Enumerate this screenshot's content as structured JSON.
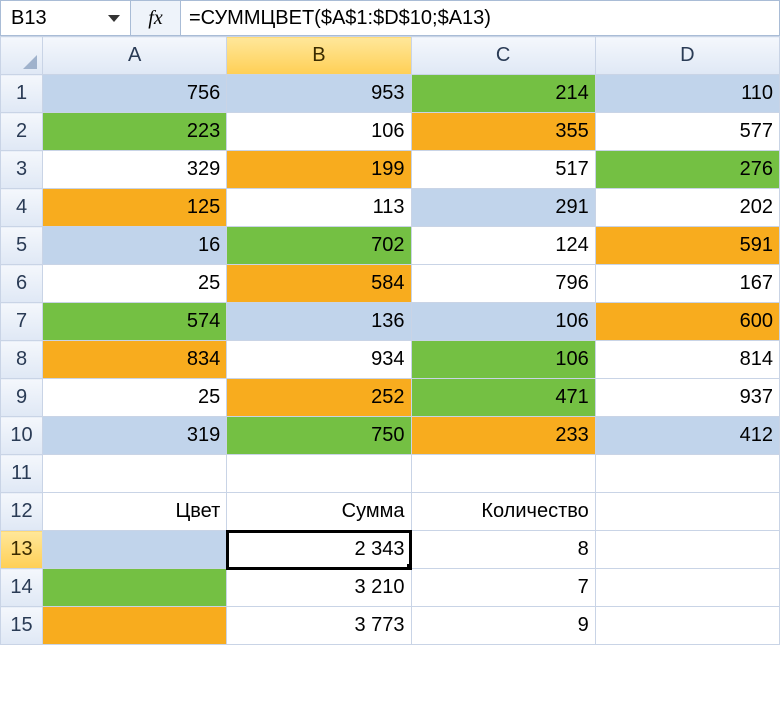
{
  "name_box": "B13",
  "fx_label": "fx",
  "formula": "=СУММЦВЕТ($A$1:$D$10;$A13)",
  "columns": [
    "A",
    "B",
    "C",
    "D"
  ],
  "selected_col": "B",
  "selected_row": "13",
  "rows": [
    "1",
    "2",
    "3",
    "4",
    "5",
    "6",
    "7",
    "8",
    "9",
    "10",
    "11",
    "12",
    "13",
    "14",
    "15"
  ],
  "grid": [
    [
      {
        "v": "756",
        "c": "blue"
      },
      {
        "v": "953",
        "c": "blue"
      },
      {
        "v": "214",
        "c": "green"
      },
      {
        "v": "110",
        "c": "blue"
      }
    ],
    [
      {
        "v": "223",
        "c": "green"
      },
      {
        "v": "106",
        "c": "none"
      },
      {
        "v": "355",
        "c": "orange"
      },
      {
        "v": "577",
        "c": "none"
      }
    ],
    [
      {
        "v": "329",
        "c": "none"
      },
      {
        "v": "199",
        "c": "orange"
      },
      {
        "v": "517",
        "c": "none"
      },
      {
        "v": "276",
        "c": "green"
      }
    ],
    [
      {
        "v": "125",
        "c": "orange"
      },
      {
        "v": "113",
        "c": "none"
      },
      {
        "v": "291",
        "c": "blue"
      },
      {
        "v": "202",
        "c": "none"
      }
    ],
    [
      {
        "v": "16",
        "c": "blue"
      },
      {
        "v": "702",
        "c": "green"
      },
      {
        "v": "124",
        "c": "none"
      },
      {
        "v": "591",
        "c": "orange"
      }
    ],
    [
      {
        "v": "25",
        "c": "none"
      },
      {
        "v": "584",
        "c": "orange"
      },
      {
        "v": "796",
        "c": "none"
      },
      {
        "v": "167",
        "c": "none"
      }
    ],
    [
      {
        "v": "574",
        "c": "green"
      },
      {
        "v": "136",
        "c": "blue"
      },
      {
        "v": "106",
        "c": "blue"
      },
      {
        "v": "600",
        "c": "orange"
      }
    ],
    [
      {
        "v": "834",
        "c": "orange"
      },
      {
        "v": "934",
        "c": "none"
      },
      {
        "v": "106",
        "c": "green"
      },
      {
        "v": "814",
        "c": "none"
      }
    ],
    [
      {
        "v": "25",
        "c": "none"
      },
      {
        "v": "252",
        "c": "orange"
      },
      {
        "v": "471",
        "c": "green"
      },
      {
        "v": "937",
        "c": "none"
      }
    ],
    [
      {
        "v": "319",
        "c": "blue"
      },
      {
        "v": "750",
        "c": "green"
      },
      {
        "v": "233",
        "c": "orange"
      },
      {
        "v": "412",
        "c": "blue"
      }
    ],
    [
      {
        "v": "",
        "c": "none"
      },
      {
        "v": "",
        "c": "none"
      },
      {
        "v": "",
        "c": "none"
      },
      {
        "v": "",
        "c": "none"
      }
    ],
    [
      {
        "v": "Цвет",
        "c": "none",
        "t": true
      },
      {
        "v": "Сумма",
        "c": "none",
        "t": true
      },
      {
        "v": "Количество",
        "c": "none",
        "t": true
      },
      {
        "v": "",
        "c": "none"
      }
    ],
    [
      {
        "v": "",
        "c": "blue"
      },
      {
        "v": "2 343",
        "c": "none",
        "sel": true
      },
      {
        "v": "8",
        "c": "none"
      },
      {
        "v": "",
        "c": "none"
      }
    ],
    [
      {
        "v": "",
        "c": "green"
      },
      {
        "v": "3 210",
        "c": "none"
      },
      {
        "v": "7",
        "c": "none"
      },
      {
        "v": "",
        "c": "none"
      }
    ],
    [
      {
        "v": "",
        "c": "orange"
      },
      {
        "v": "3 773",
        "c": "none"
      },
      {
        "v": "9",
        "c": "none"
      },
      {
        "v": "",
        "c": "none"
      }
    ]
  ],
  "chart_data": {
    "type": "table",
    "title": "Spreadsheet data with color-coded cells and sum-by-color results",
    "columns": [
      "A",
      "B",
      "C",
      "D"
    ],
    "values": [
      [
        756,
        953,
        214,
        110
      ],
      [
        223,
        106,
        355,
        577
      ],
      [
        329,
        199,
        517,
        276
      ],
      [
        125,
        113,
        291,
        202
      ],
      [
        16,
        702,
        124,
        591
      ],
      [
        25,
        584,
        796,
        167
      ],
      [
        574,
        136,
        106,
        600
      ],
      [
        834,
        934,
        106,
        814
      ],
      [
        25,
        252,
        471,
        937
      ],
      [
        319,
        750,
        233,
        412
      ]
    ],
    "cell_colors": [
      [
        "blue",
        "blue",
        "green",
        "blue"
      ],
      [
        "green",
        "none",
        "orange",
        "none"
      ],
      [
        "none",
        "orange",
        "none",
        "green"
      ],
      [
        "orange",
        "none",
        "blue",
        "none"
      ],
      [
        "blue",
        "green",
        "none",
        "orange"
      ],
      [
        "none",
        "orange",
        "none",
        "none"
      ],
      [
        "green",
        "blue",
        "blue",
        "orange"
      ],
      [
        "orange",
        "none",
        "green",
        "none"
      ],
      [
        "none",
        "orange",
        "green",
        "none"
      ],
      [
        "blue",
        "green",
        "orange",
        "blue"
      ]
    ],
    "summary": {
      "headers": [
        "Цвет",
        "Сумма",
        "Количество"
      ],
      "rows": [
        {
          "color": "blue",
          "sum": 2343,
          "count": 8
        },
        {
          "color": "green",
          "sum": 3210,
          "count": 7
        },
        {
          "color": "orange",
          "sum": 3773,
          "count": 9
        }
      ]
    }
  }
}
